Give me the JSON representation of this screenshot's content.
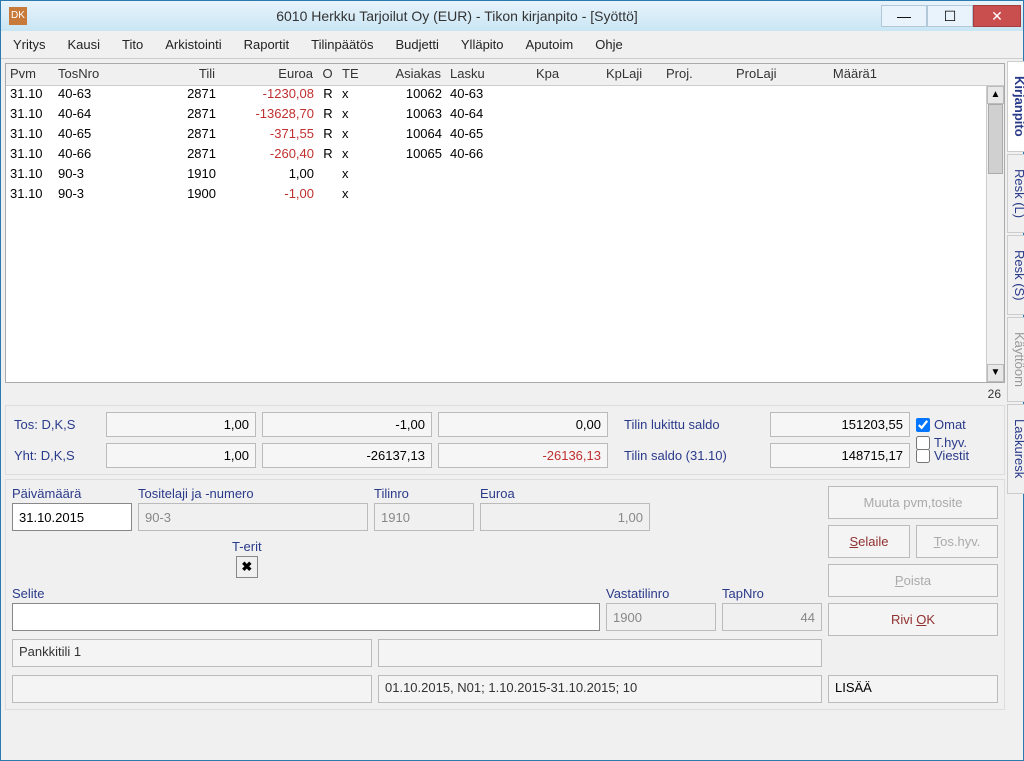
{
  "titlebar": {
    "title": "6010  Herkku Tarjoilut Oy (EUR) - Tikon kirjanpito - [Syöttö]"
  },
  "menu": {
    "yritys": "Yritys",
    "kausi": "Kausi",
    "tito": "Tito",
    "arkistointi": "Arkistointi",
    "raportit": "Raportit",
    "tilinpaatos": "Tilinpäätös",
    "budjetti": "Budjetti",
    "yllapito": "Ylläpito",
    "aputoim": "Aputoim",
    "ohje": "Ohje"
  },
  "side_tabs": {
    "kirjanpito": "Kirjanpito",
    "resk_l": "Resk (L)",
    "resk_s": "Resk (S)",
    "kayttoom": "Käyttöom",
    "laskuresk": "Laskuresk"
  },
  "grid": {
    "headers": {
      "pvm": "Pvm",
      "tosnro": "TosNro",
      "tili": "Tili",
      "euroa": "Euroa",
      "o": "O",
      "te": "TE",
      "asiakas": "Asiakas",
      "lasku": "Lasku",
      "kpa": "Kpa",
      "kplaji": "KpLaji",
      "proj": "Proj.",
      "prolaji": "ProLaji",
      "maara": "Määrä1"
    },
    "rows": [
      {
        "pvm": "31.10",
        "tosnro": "40-63",
        "tili": "2871",
        "euroa": "-1230,08",
        "neg": true,
        "o": "R",
        "te": "x",
        "asiakas": "10062",
        "lasku": "40-63"
      },
      {
        "pvm": "31.10",
        "tosnro": "40-64",
        "tili": "2871",
        "euroa": "-13628,70",
        "neg": true,
        "o": "R",
        "te": "x",
        "asiakas": "10063",
        "lasku": "40-64"
      },
      {
        "pvm": "31.10",
        "tosnro": "40-65",
        "tili": "2871",
        "euroa": "-371,55",
        "neg": true,
        "o": "R",
        "te": "x",
        "asiakas": "10064",
        "lasku": "40-65"
      },
      {
        "pvm": "31.10",
        "tosnro": "40-66",
        "tili": "2871",
        "euroa": "-260,40",
        "neg": true,
        "o": "R",
        "te": "x",
        "asiakas": "10065",
        "lasku": "40-66"
      },
      {
        "pvm": "31.10",
        "tosnro": "90-3",
        "tili": "1910",
        "euroa": "1,00",
        "neg": false,
        "o": "",
        "te": "x",
        "asiakas": "",
        "lasku": ""
      },
      {
        "pvm": "31.10",
        "tosnro": "90-3",
        "tili": "1900",
        "euroa": "-1,00",
        "neg": true,
        "o": "",
        "te": "x",
        "asiakas": "",
        "lasku": ""
      }
    ],
    "row_count": "26"
  },
  "summary": {
    "tos_label": "Tos: D,K,S",
    "tos_v1": "1,00",
    "tos_v2": "-1,00",
    "tos_v3": "0,00",
    "tilin_lukittu_label": "Tilin lukittu saldo",
    "tilin_lukittu": "151203,55",
    "yht_label": "Yht: D,K,S",
    "yht_v1": "1,00",
    "yht_v2": "-26137,13",
    "yht_v3": "-26136,13",
    "tilin_saldo_label": "Tilin saldo (31.10)",
    "tilin_saldo": "148715,17",
    "omat": "Omat",
    "thyv": "T.hyv.",
    "viestit": "Viestit"
  },
  "entry": {
    "paivamaara_label": "Päivämäärä",
    "paivamaara": "31.10.2015",
    "tositelaji_label": "Tositelaji ja -numero",
    "tositelaji": "90-3",
    "tilinro_label": "Tilinro",
    "tilinro": "1910",
    "euroa_label": "Euroa",
    "euroa": "1,00",
    "terit_label": "T-erit",
    "terit_mark": "✖",
    "selite_label": "Selite",
    "selite": "",
    "vastatilinro_label": "Vastatilinro",
    "vastatilinro": "1900",
    "tapnro_label": "TapNro",
    "tapnro": "44",
    "status1": "Pankkitili 1",
    "status2": "",
    "status3": "01.10.2015, N01; 1.10.2015-31.10.2015; 10",
    "status4": "LISÄÄ"
  },
  "buttons": {
    "muuta": "Muuta pvm,tosite",
    "selaile": "Selaile",
    "toshyv": "Tos.hyv.",
    "poista": "Poista",
    "rivi_ok": "Rivi OK"
  }
}
